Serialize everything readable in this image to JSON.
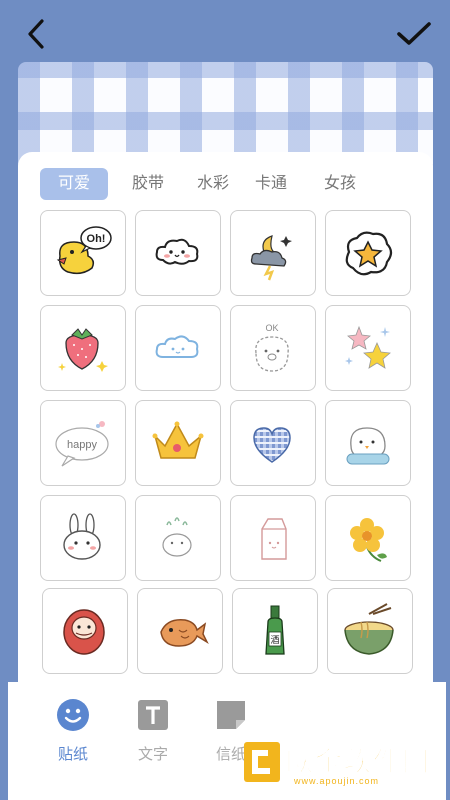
{
  "topbar": {
    "back_icon": "chevron-left-icon",
    "confirm_icon": "checkmark-icon"
  },
  "tabs": [
    {
      "label": "可爱",
      "active": true
    },
    {
      "label": "胶带",
      "active": false
    },
    {
      "label": "水彩",
      "active": false
    },
    {
      "label": "卡通",
      "active": false
    },
    {
      "label": "女孩",
      "active": false
    }
  ],
  "stickers": [
    {
      "name": "duck-oh-sticker",
      "text": "Oh!"
    },
    {
      "name": "cloud-face-sticker"
    },
    {
      "name": "moon-storm-sticker"
    },
    {
      "name": "star-bubble-sticker"
    },
    {
      "name": "strawberry-sticker"
    },
    {
      "name": "blue-cloud-sticker"
    },
    {
      "name": "ok-bear-sticker",
      "text": "OK"
    },
    {
      "name": "sparkle-stars-sticker"
    },
    {
      "name": "happy-bubble-sticker",
      "text": "happy"
    },
    {
      "name": "crown-sticker"
    },
    {
      "name": "plaid-heart-sticker"
    },
    {
      "name": "fluffy-bird-sticker"
    },
    {
      "name": "bunny-face-sticker"
    },
    {
      "name": "bunny-splash-sticker"
    },
    {
      "name": "milk-carton-sticker"
    },
    {
      "name": "yellow-flower-sticker"
    },
    {
      "name": "daruma-sticker"
    },
    {
      "name": "taiyaki-sticker"
    },
    {
      "name": "sake-bottle-sticker",
      "text": "酒"
    },
    {
      "name": "ramen-bowl-sticker"
    }
  ],
  "bottom_nav": [
    {
      "label": "贴纸",
      "icon": "smiley-sticker-icon",
      "active": true
    },
    {
      "label": "文字",
      "icon": "text-t-icon",
      "active": false
    },
    {
      "label": "信纸",
      "icon": "letter-paper-icon",
      "active": false
    }
  ],
  "watermark": {
    "title": "欧金软件园",
    "url": "www.apoujin.com"
  },
  "colors": {
    "background": "#6f8dc3",
    "tab_active": "#a9c0ea",
    "nav_active": "#5a86cf",
    "watermark": "#f2b51d"
  }
}
